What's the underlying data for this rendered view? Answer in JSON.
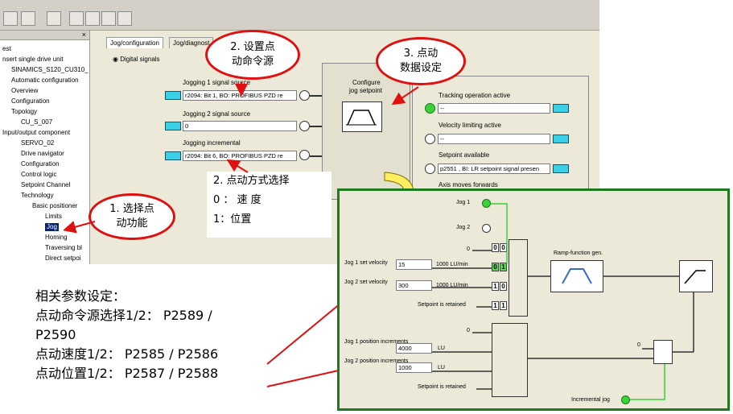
{
  "tree": {
    "items": [
      "est",
      "nsert single drive unit",
      "SINAMICS_S120_CU310_",
      "Automatic configuration",
      "Overview",
      "Configuration",
      "Topology",
      "CU_S_007",
      "Input/output component",
      "SERVO_02",
      "Drive navigator",
      "Configuration",
      "Control logic",
      "Setpoint Channel",
      "Technology",
      "Basic positioner",
      "Limits",
      "Jog",
      "Homing",
      "Traversing bl",
      "Direct setpoi"
    ]
  },
  "tabs": [
    "Jog/configuration",
    "Jog/diagnost"
  ],
  "radio_label": "Digital signals",
  "jog1": {
    "label": "Jogging 1 signal source",
    "value": "r2094: Bit 1, BO: PROFIBUS PZD re"
  },
  "jog2": {
    "label": "Jogging 2 signal source",
    "value": "0"
  },
  "jog_inc": {
    "label": "Jogging incremental",
    "value": "r2094: Bit 6, BO: PROFIBUS PZD re"
  },
  "configure": {
    "label1": "Configure",
    "label2": "jog setpoint"
  },
  "status": {
    "tracking": {
      "label": "Tracking operation active",
      "value": "--"
    },
    "vel_limit": {
      "label": "Velocity limiting active",
      "value": "--"
    },
    "setpoint": {
      "label": "Setpoint available",
      "value": "p2551 , BI: LR setpoint signal presen"
    },
    "axis": {
      "label": "Axis moves forwards"
    }
  },
  "callouts": {
    "c1": "1. 选择点\n动功能",
    "c2": "2. 设置点\n动命令源",
    "c3": "3. 点动\n数据设定",
    "c4a": "2.  点动方式选择",
    "c4b": "0    ：  速    度",
    "c4c": "1：位置"
  },
  "diagram": {
    "jog1": "Jog 1",
    "jog2": "Jog 2",
    "zero1": "0",
    "jog1_vel_label": "Jog 1 set velocity",
    "jog1_vel": "15",
    "jog2_vel_label": "Jog 2 set velocity",
    "jog2_vel": "300",
    "unit_vel1": "1000 LU/min",
    "unit_vel2": "1000 LU/min",
    "retained1": "Setpoint is retained",
    "zero2": "0",
    "jog1_pos_label": "Jog 1 position increments",
    "jog1_pos": "4000",
    "jog2_pos_label": "Jog 2 position increments",
    "jog2_pos": "1000",
    "unit_lu1": "LU",
    "unit_lu2": "LU",
    "retained2": "Setpoint is retained",
    "ramp": "Ramp-function gen.",
    "zero3": "0",
    "incremental": "Incremental jog",
    "bits": [
      "0",
      "0",
      "0",
      "1",
      "1",
      "0",
      "1",
      "1"
    ]
  },
  "notes": {
    "title": "相关参数设定：",
    "line1": "点动命令源选择1/2：  P2589 /",
    "line1b": "P2590",
    "line2": "点动速度1/2：  P2585 / P2586",
    "line3": "点动位置1/2：  P2587 / P2588"
  }
}
